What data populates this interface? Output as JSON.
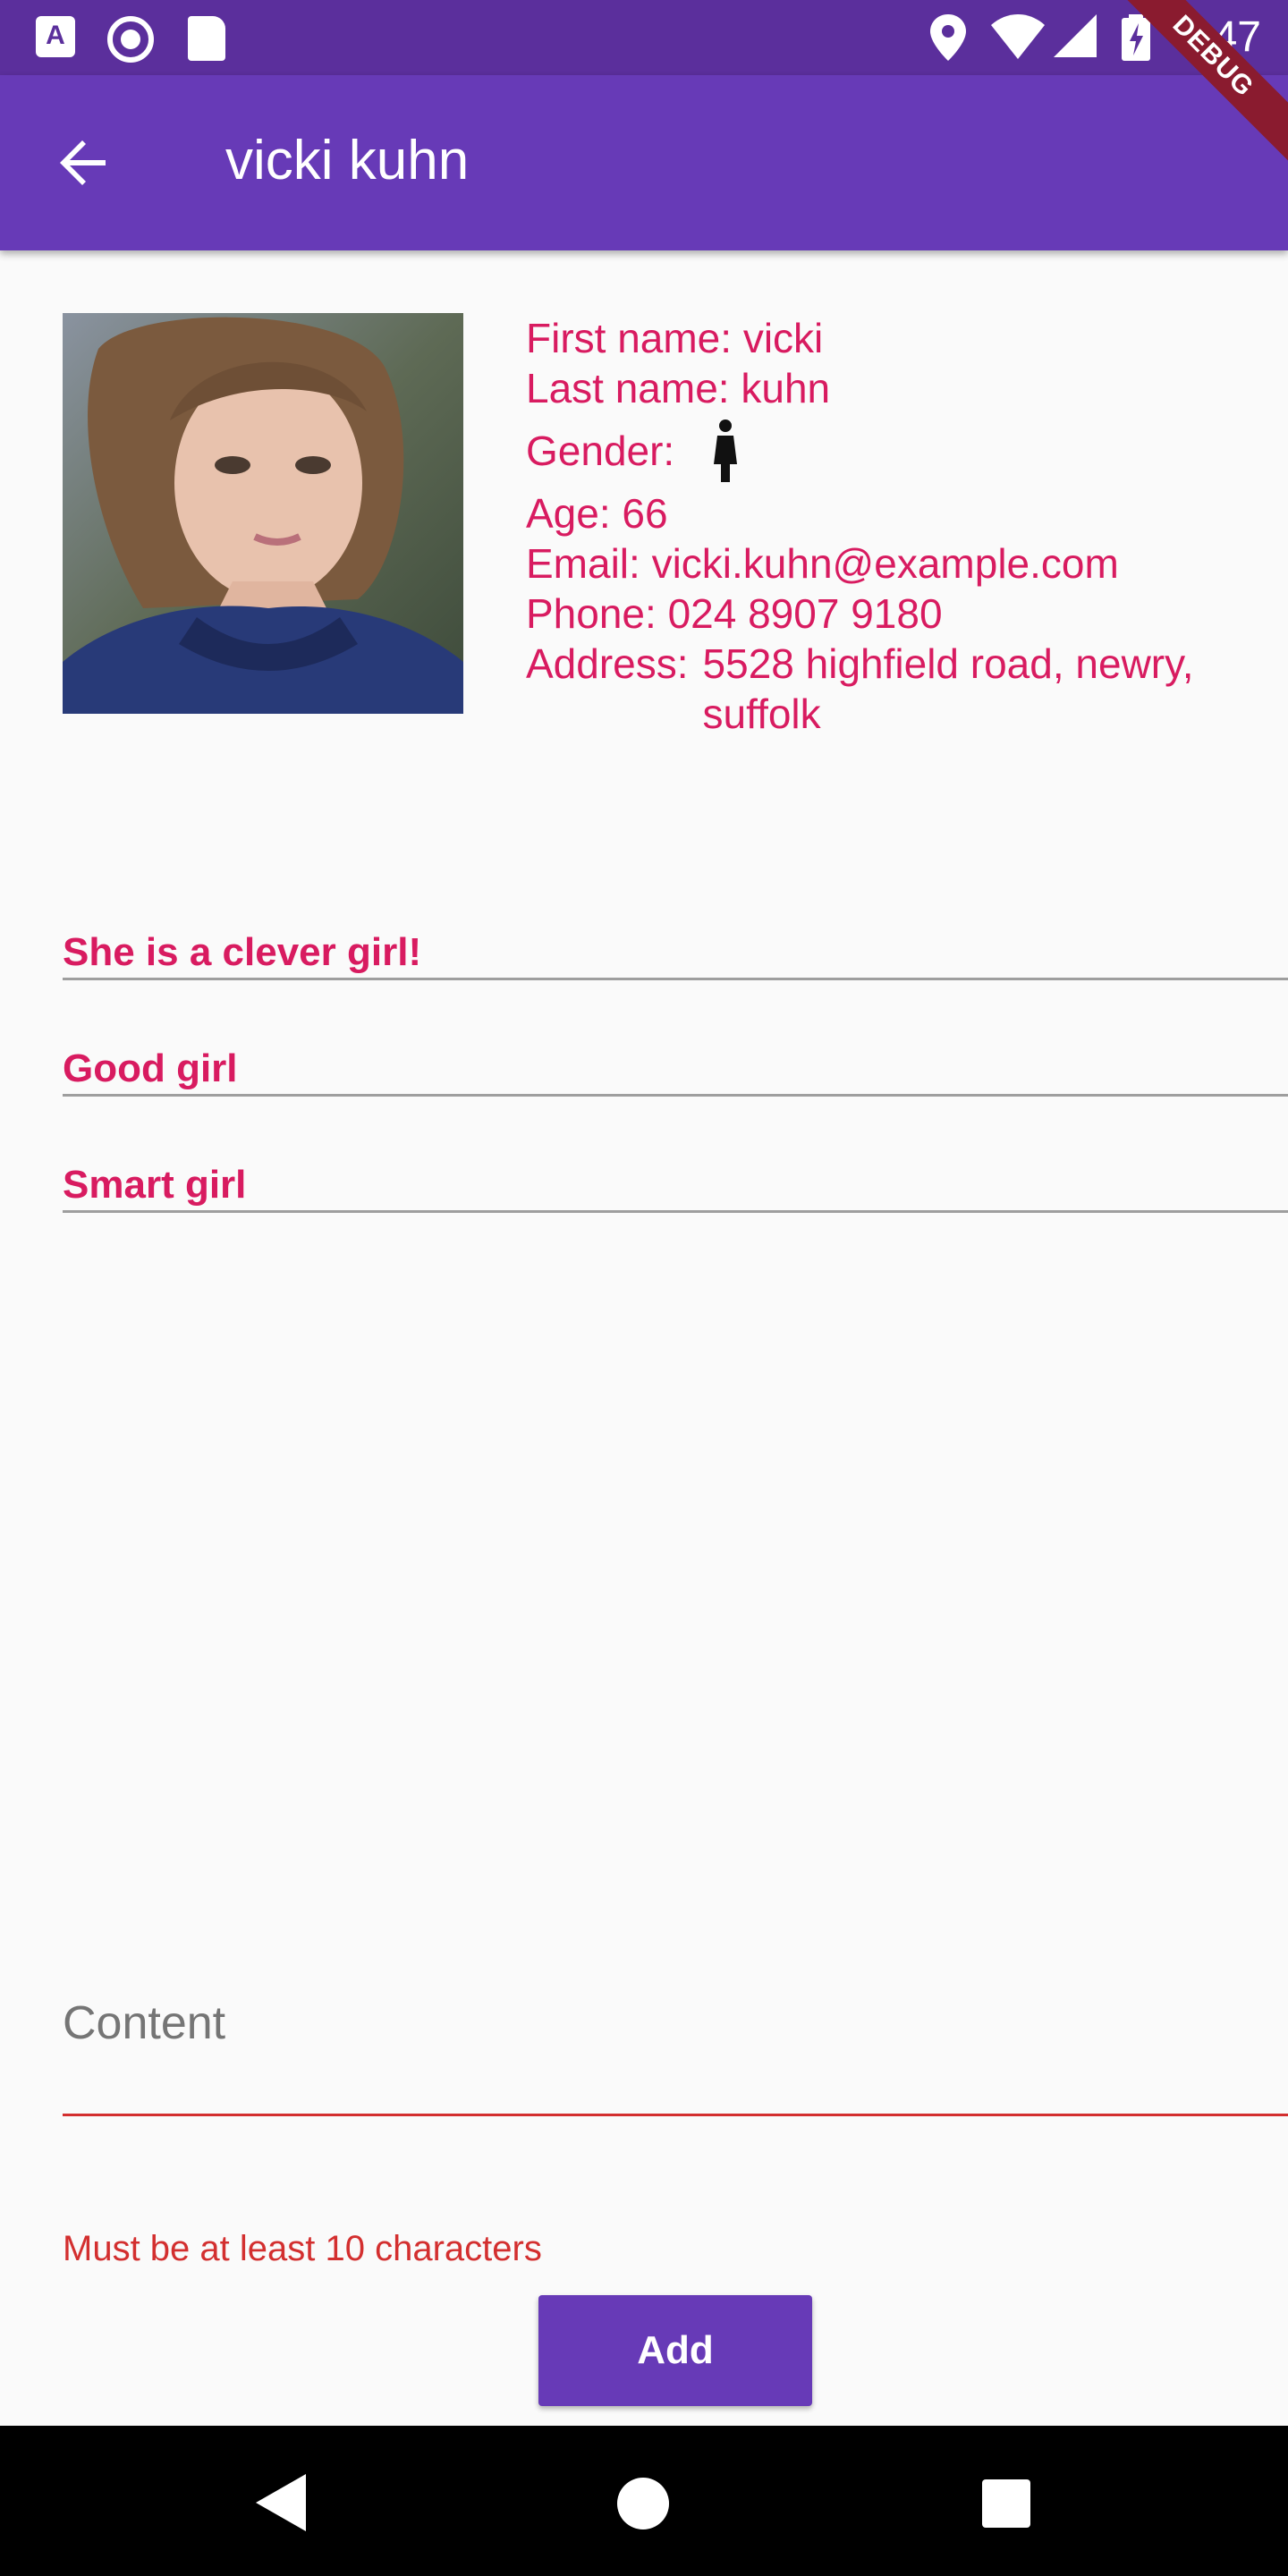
{
  "status_bar": {
    "time": "3:47",
    "icons": [
      "text-icon",
      "record-icon",
      "sd-card-icon",
      "location-icon",
      "wifi-icon",
      "signal-icon",
      "battery-charging-icon"
    ]
  },
  "debug_banner": "DEBUG",
  "app_bar": {
    "title": "vicki kuhn",
    "back_icon": "arrow-back-icon",
    "color": "#673ab7"
  },
  "profile": {
    "first_name": "First name: vicki",
    "last_name": "Last name: kuhn",
    "gender_label": "Gender:",
    "gender_icon": "female-icon",
    "age": "Age: 66",
    "email": "Email: vicki.kuhn@example.com",
    "phone": "Phone: 024 8907 9180",
    "address_label": "Address:",
    "address_value": "5528 highfield road, newry, suffolk",
    "text_color": "#d81b60"
  },
  "notes": [
    "She is a clever girl!",
    "Good girl",
    "Smart girl"
  ],
  "form": {
    "content_label": "Content",
    "content_value": "",
    "error": "Must be at least 10 characters",
    "error_color": "#d32f2f",
    "add_label": "Add"
  }
}
